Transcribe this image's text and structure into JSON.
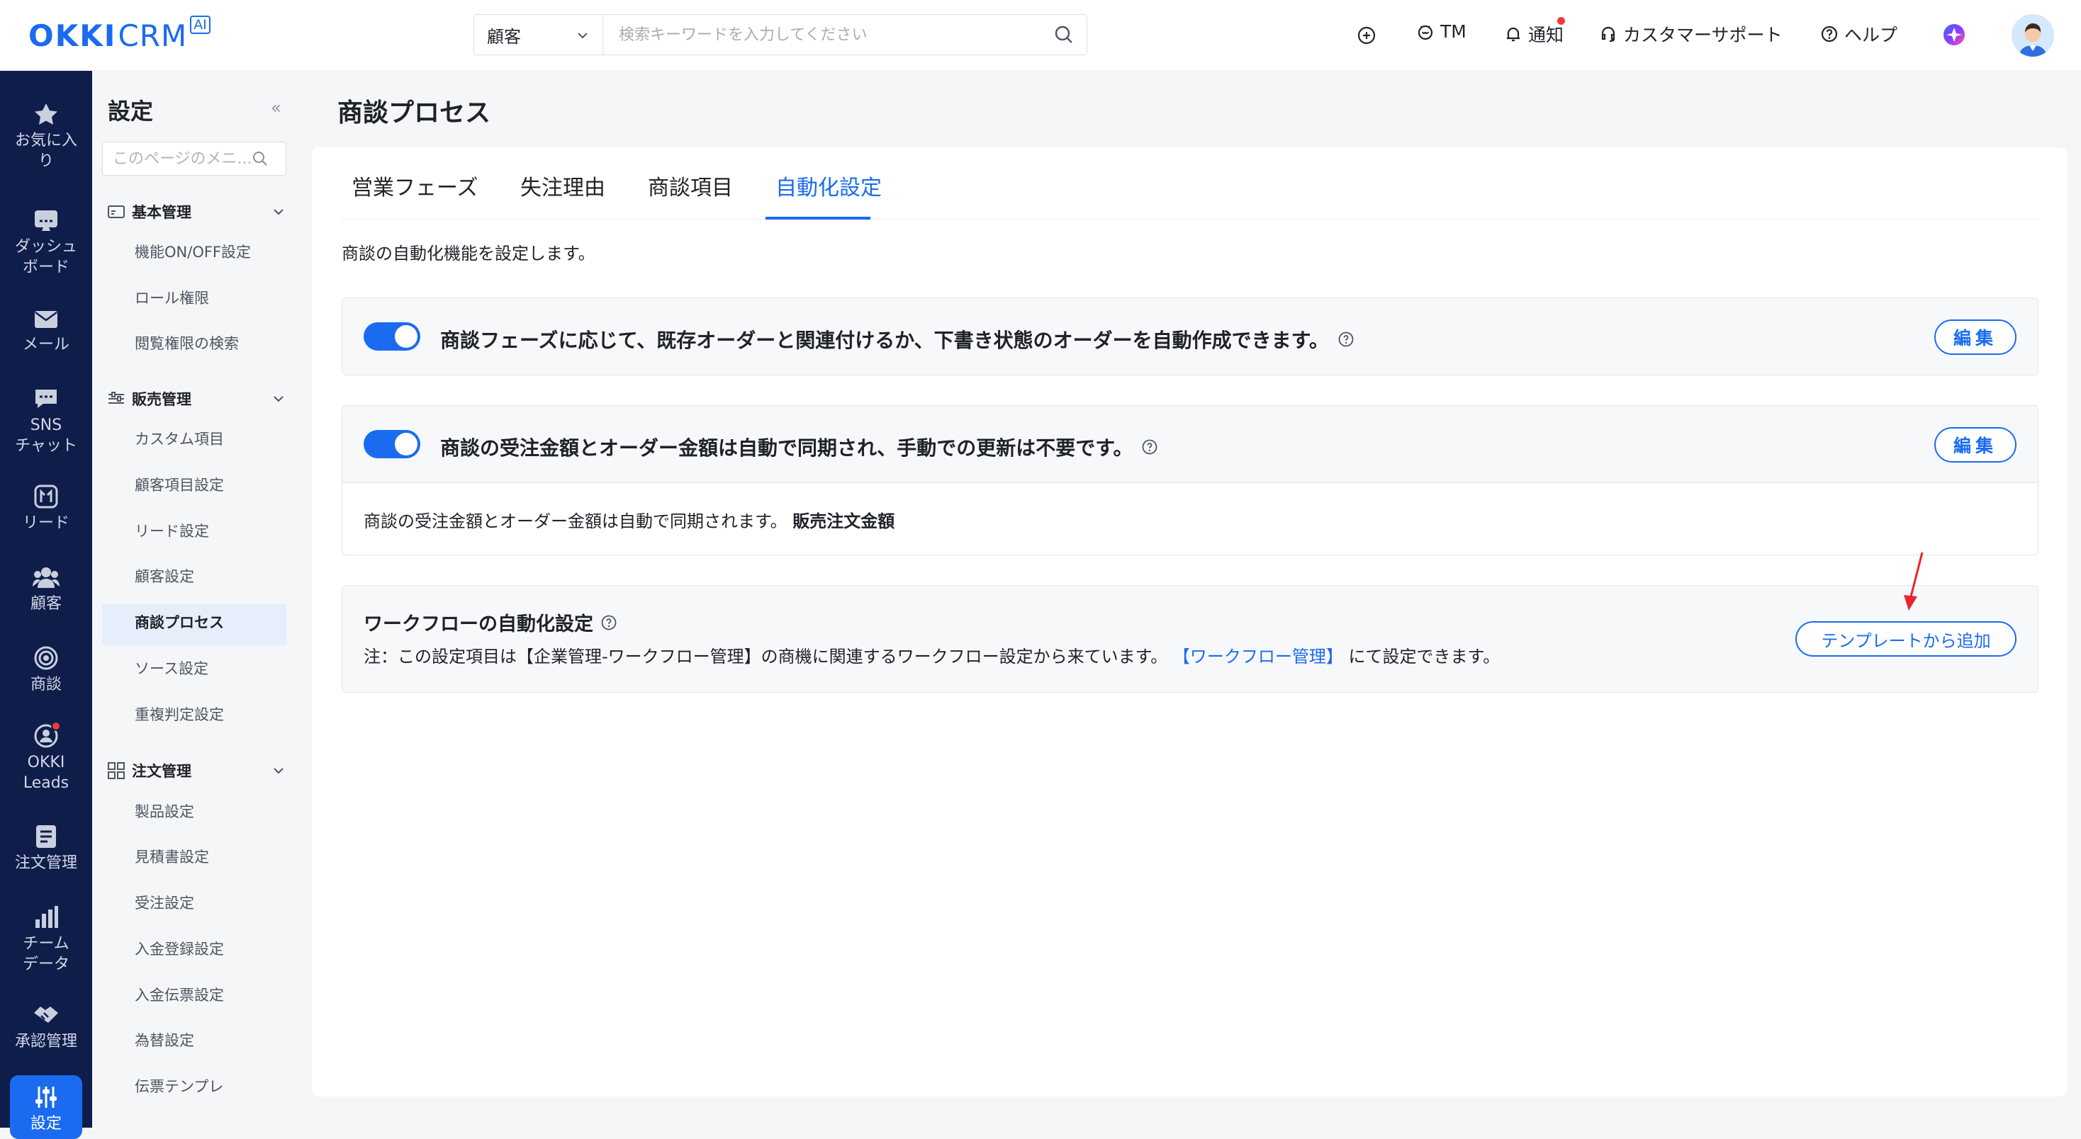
{
  "header": {
    "logo_text": "OKKI",
    "logo_crm": "CRM",
    "logo_ai": "AI",
    "search_type": "顧客",
    "search_placeholder": "検索キーワードを入力してください",
    "tm_label": "TM",
    "notify_label": "通知",
    "support_label": "カスタマーサポート",
    "help_label": "ヘルプ"
  },
  "leftnav": {
    "items": [
      {
        "label": "お気に入り",
        "icon": "star-icon"
      },
      {
        "label": "ダッシュボード",
        "icon": "dashboard-icon"
      },
      {
        "label": "メール",
        "icon": "mail-icon"
      },
      {
        "label": "SNSチャット",
        "icon": "chat-icon"
      },
      {
        "label": "リード",
        "icon": "lead-icon"
      },
      {
        "label": "顧客",
        "icon": "customers-icon"
      },
      {
        "label": "商談",
        "icon": "target-icon"
      },
      {
        "label": "OKKI Leads",
        "icon": "okki-leads-icon"
      },
      {
        "label": "注文管理",
        "icon": "document-icon"
      },
      {
        "label": "チームデータ",
        "icon": "bar-chart-icon"
      },
      {
        "label": "承認管理",
        "icon": "handshake-icon"
      },
      {
        "label": "設定",
        "icon": "sliders-icon"
      }
    ],
    "lines": {
      "fav1": "お気に入",
      "fav2": "り",
      "dash1": "ダッシュ",
      "dash2": "ボード",
      "mail": "メール",
      "sns1": "SNS",
      "sns2": "チャット",
      "lead": "リード",
      "cust": "顧客",
      "deal": "商談",
      "okki1": "OKKI",
      "okki2": "Leads",
      "order": "注文管理",
      "team1": "チーム",
      "team2": "データ",
      "approve": "承認管理",
      "settings": "設定"
    }
  },
  "submenu": {
    "title": "設定",
    "collapse": "«",
    "search_placeholder": "このページのメニ...",
    "groups": [
      {
        "label": "基本管理",
        "items": [
          "機能ON/OFF設定",
          "ロール権限",
          "閲覧権限の検索"
        ]
      },
      {
        "label": "販売管理",
        "items": [
          "カスタム項目",
          "顧客項目設定",
          "リード設定",
          "顧客設定",
          "商談プロセス",
          "ソース設定",
          "重複判定設定"
        ]
      },
      {
        "label": "注文管理",
        "items": [
          "製品設定",
          "見積書設定",
          "受注設定",
          "入金登録設定",
          "入金伝票設定",
          "為替設定",
          "伝票テンプレ"
        ]
      }
    ],
    "active_item": "商談プロセス"
  },
  "main": {
    "title": "商談プロセス",
    "tabs": [
      {
        "label": "営業フェーズ",
        "active": false
      },
      {
        "label": "失注理由",
        "active": false
      },
      {
        "label": "商談項目",
        "active": false
      },
      {
        "label": "自動化設定",
        "active": true
      }
    ],
    "description": "商談の自動化機能を設定します。",
    "rules": [
      {
        "enabled": true,
        "text": "商談フェーズに応じて、既存オーダーと関連付けるか、下書き状態のオーダーを自動作成できます。",
        "edit_label": "編集"
      },
      {
        "enabled": true,
        "text": "商談の受注金額とオーダー金額は自動で同期され、手動での更新は不要です。",
        "edit_label": "編集",
        "detail_text": "商談の受注金額とオーダー金額は自動で同期されます。",
        "detail_bold": "販売注文金額"
      }
    ],
    "workflow": {
      "title": "ワークフローの自動化設定",
      "note_prefix": "注：この設定項目は【企業管理-ワークフロー管理】の商機に関連するワークフロー設定から来ています。",
      "note_link": "【ワークフロー管理】",
      "note_suffix": "にて設定できます。",
      "button_label": "テンプレートから追加"
    }
  },
  "colors": {
    "accent": "#1a6bf0",
    "nav_bg": "#0f1d4a",
    "alert": "#f03a3a"
  }
}
